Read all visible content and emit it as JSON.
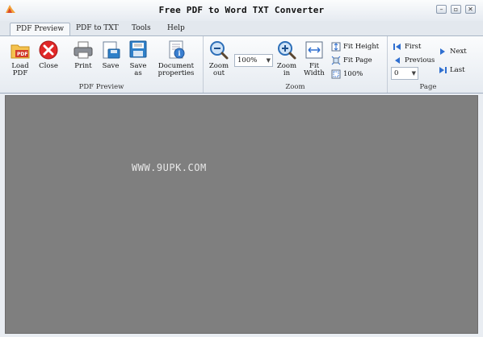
{
  "window": {
    "title": "Free PDF to Word TXT Converter",
    "minimize_glyph": "–",
    "restore_glyph": "▫",
    "close_glyph": "✕"
  },
  "tabs": [
    {
      "label": "PDF Preview",
      "active": true
    },
    {
      "label": "PDF to TXT",
      "active": false
    },
    {
      "label": "Tools",
      "active": false
    },
    {
      "label": "Help",
      "active": false
    }
  ],
  "ribbon": {
    "pdf_preview": {
      "label": "PDF Preview",
      "load_pdf": "Load\nPDF",
      "close": "Close",
      "print": "Print",
      "save": "Save",
      "save_as": "Save\nas",
      "document_properties": "Document\nproperties"
    },
    "zoom": {
      "label": "Zoom",
      "zoom_out": "Zoom\nout",
      "zoom_value": "100%",
      "zoom_in": "Zoom\nin",
      "fit_width": "Fit\nWidth",
      "fit_height": "Fit Height",
      "fit_page": "Fit Page",
      "hundred": "100%"
    },
    "page": {
      "label": "Page",
      "first": "First",
      "next": "Next",
      "previous": "Previous",
      "last": "Last",
      "page_value": "0"
    }
  },
  "content": {
    "watermark": "WWW.9UPK.COM"
  },
  "colors": {
    "accent_blue": "#2f6fd0",
    "close_red": "#e02828",
    "preview_bg": "#7f7f7f"
  }
}
